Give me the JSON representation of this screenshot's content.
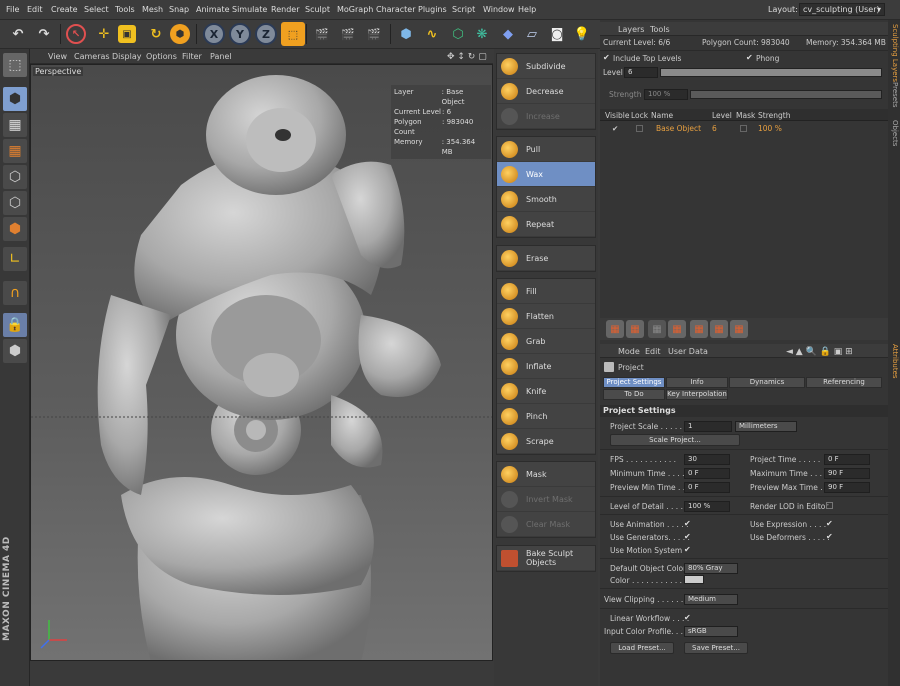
{
  "menu": [
    "File",
    "Edit",
    "Create",
    "Select",
    "Tools",
    "Mesh",
    "Snap",
    "Animate",
    "Simulate",
    "Render",
    "Sculpt",
    "MoGraph",
    "Character",
    "Plugins",
    "Script",
    "Window",
    "Help"
  ],
  "layout": {
    "label": "Layout:",
    "value": "cv_sculpting (User)"
  },
  "viewport": {
    "menu": [
      "View",
      "Cameras",
      "Display",
      "Options",
      "Filter",
      "Panel"
    ],
    "label": "Perspective",
    "info": [
      {
        "k": "Layer",
        "v": ": Base Object"
      },
      {
        "k": "Current Level",
        "v": ": 6"
      },
      {
        "k": "Polygon Count",
        "v": ": 983040"
      },
      {
        "k": "Memory",
        "v": ": 354.364 MB"
      }
    ],
    "brand": "MAXON CINEMA 4D"
  },
  "tools": [
    {
      "label": "Subdivide",
      "state": "normal"
    },
    {
      "label": "Decrease",
      "state": "normal"
    },
    {
      "label": "Increase",
      "state": "disabled"
    },
    {
      "label": "Pull",
      "state": "normal"
    },
    {
      "label": "Wax",
      "state": "selected"
    },
    {
      "label": "Smooth",
      "state": "normal"
    },
    {
      "label": "Repeat",
      "state": "normal"
    },
    {
      "label": "Erase",
      "state": "normal"
    },
    {
      "label": "Fill",
      "state": "normal"
    },
    {
      "label": "Flatten",
      "state": "normal"
    },
    {
      "label": "Grab",
      "state": "normal"
    },
    {
      "label": "Inflate",
      "state": "normal"
    },
    {
      "label": "Knife",
      "state": "normal"
    },
    {
      "label": "Pinch",
      "state": "normal"
    },
    {
      "label": "Scrape",
      "state": "normal"
    },
    {
      "label": "Mask",
      "state": "normal"
    },
    {
      "label": "Invert Mask",
      "state": "disabled"
    },
    {
      "label": "Clear Mask",
      "state": "disabled"
    },
    {
      "label": "Bake Sculpt Objects",
      "state": "normal"
    }
  ],
  "layers": {
    "menu": [
      "Layers",
      "Tools"
    ],
    "current_level": "Current Level: 6/6",
    "polygon_count": "Polygon Count: 983040",
    "memory": "Memory: 354.364 MB",
    "include_top": "Include Top Levels",
    "phong": "Phong",
    "level_label": "Level",
    "level_value": "6",
    "strength_label": "Strength",
    "strength_value": "100 %",
    "columns": [
      "Visible",
      "Lock",
      "Name",
      "Level",
      "Mask",
      "Strength"
    ],
    "row": {
      "visible": "✔",
      "name": "Base Object",
      "level": "6",
      "strength": "100 %"
    }
  },
  "vtabs": {
    "sculpt": "Sculpting Layers",
    "presets": "Presets",
    "objects": "Objects",
    "attributes": "Attributes"
  },
  "attributes": {
    "menu": [
      "Mode",
      "Edit",
      "User Data"
    ],
    "object": "Project",
    "tabs_row1": [
      "Project Settings",
      "Info",
      "Dynamics",
      "Referencing"
    ],
    "tabs_row2": [
      "To Do",
      "Key Interpolation"
    ],
    "section": "Project Settings",
    "project_scale_label": "Project Scale . . . . . .",
    "project_scale_value": "1",
    "project_scale_unit": "Millimeters",
    "scale_project_btn": "Scale Project...",
    "fps_label": "FPS . . . . . . . . . . .",
    "fps_value": "30",
    "project_time_label": "Project Time . . . . .",
    "project_time_value": "0 F",
    "min_time_label": "Minimum Time . . . .",
    "min_time_value": "0 F",
    "max_time_label": "Maximum Time . . .",
    "max_time_value": "90 F",
    "prev_min_label": "Preview Min Time . .",
    "prev_min_value": "0 F",
    "prev_max_label": "Preview Max Time . .",
    "prev_max_value": "90 F",
    "lod_label": "Level of Detail . . . . .",
    "lod_value": "100 %",
    "render_lod_label": "Render LOD in Editor",
    "use_animation": "Use Animation . . . . .",
    "use_expression": "Use Expression . . . .",
    "use_generators": "Use Generators. . . . .",
    "use_deformers": "Use Deformers . . . . .",
    "use_motion": "Use Motion System",
    "default_color_label": "Default Object Color",
    "default_color_value": "80% Gray",
    "color_label": "Color . . . . . . . . . . .",
    "view_clipping_label": "View Clipping . . . . . .",
    "view_clipping_value": "Medium",
    "linear_workflow": "Linear Workflow . . . .",
    "input_profile_label": "Input Color Profile. . .",
    "input_profile_value": "sRGB",
    "load_preset": "Load Preset...",
    "save_preset": "Save Preset...",
    "check": "✔"
  },
  "colors": {
    "accent": "#6f8fc4",
    "highlight": "#e8a040"
  }
}
